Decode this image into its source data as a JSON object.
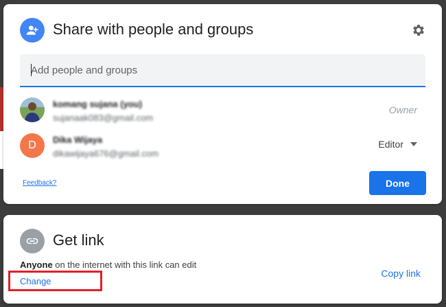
{
  "share": {
    "title": "Share with people and groups",
    "input_placeholder": "Add people and groups",
    "people": [
      {
        "name": "komang sujana (you)",
        "email": "sujanaak083@gmail.com",
        "role": "Owner"
      },
      {
        "name": "Dika Wijaya",
        "email": "dikawijaya676@gmail.com",
        "role": "Editor",
        "initial": "D"
      }
    ],
    "feedback_label": "Feedback?",
    "done_label": "Done"
  },
  "link": {
    "title": "Get link",
    "access_bold": "Anyone",
    "access_rest": " on the internet with this link can edit",
    "change_label": "Change",
    "copy_label": "Copy link"
  },
  "colors": {
    "primary": "#1a73e8",
    "share_icon": "#4285f4",
    "avatar_d": "#f2784b",
    "highlight": "#e02028"
  },
  "icons": {
    "share": "person-add-icon",
    "settings": "gear-icon",
    "link": "link-icon",
    "dropdown": "caret-down-icon"
  }
}
